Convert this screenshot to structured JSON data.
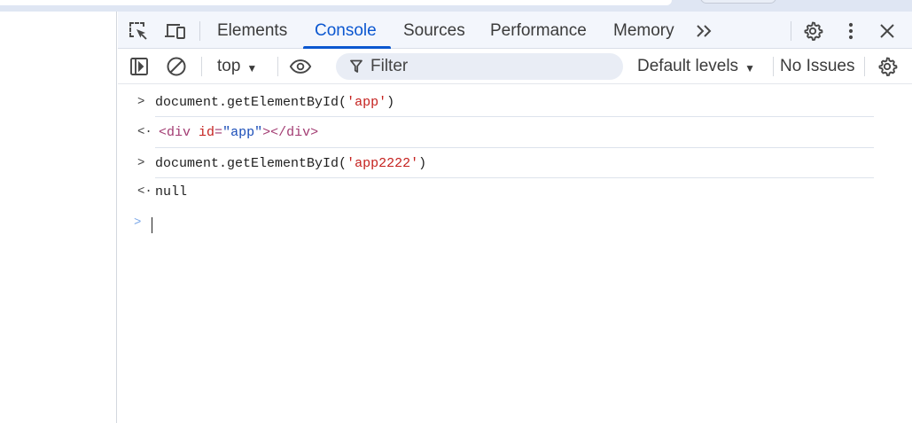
{
  "tabs": {
    "items": [
      {
        "label": "Elements"
      },
      {
        "label": "Console"
      },
      {
        "label": "Sources"
      },
      {
        "label": "Performance"
      },
      {
        "label": "Memory"
      }
    ],
    "more": "»",
    "icons": {
      "inspect": "inspect-element-icon",
      "device": "device-toolbar-icon",
      "settings": "gear-icon",
      "menu": "kebab-menu-icon",
      "close": "close-icon"
    }
  },
  "toolbar": {
    "context": "top",
    "filter_placeholder": "Filter",
    "levels": "Default levels",
    "issues": "No Issues"
  },
  "console": {
    "entries": [
      {
        "type": "input",
        "prompt": ">",
        "code": "document.getElementById",
        "open": "(",
        "arg": "'app'",
        "close": ")"
      },
      {
        "type": "output",
        "prompt": "<·",
        "open_tag": "<div",
        "attr": "id",
        "eq": "=",
        "aval": "\"app\"",
        "rest": "></div>"
      },
      {
        "type": "input",
        "prompt": ">",
        "code": "document.getElementById",
        "open": "(",
        "arg": "'app2222'",
        "close": ")"
      },
      {
        "type": "output",
        "prompt": "<·",
        "value": "null"
      },
      {
        "type": "prompt",
        "prompt": ">"
      }
    ]
  },
  "colors": {
    "accent": "#0b57d0",
    "tabbar_bg": "#f3f6fc",
    "string": "#c5221f",
    "null": "#9aa0a6"
  }
}
